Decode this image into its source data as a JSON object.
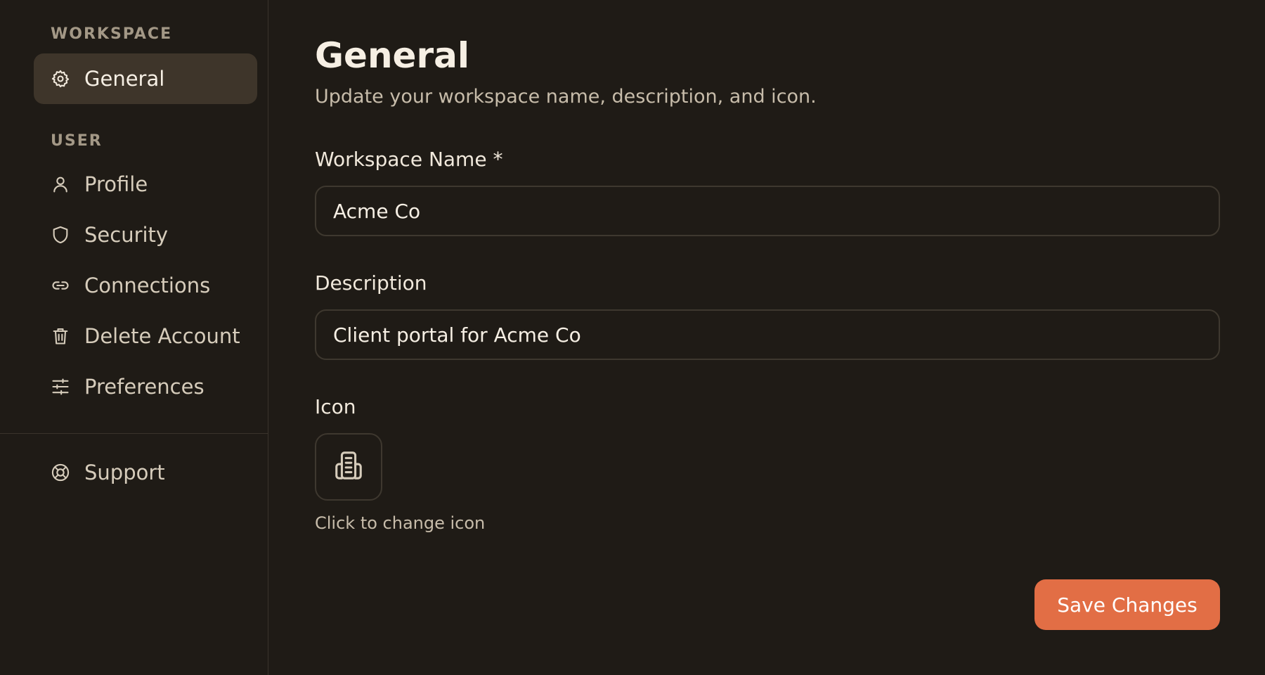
{
  "sidebar": {
    "workspace_label": "WORKSPACE",
    "user_label": "USER",
    "items": [
      {
        "label": "General",
        "icon": "gear-icon",
        "active": true
      },
      {
        "label": "Profile",
        "icon": "user-icon",
        "active": false
      },
      {
        "label": "Security",
        "icon": "shield-icon",
        "active": false
      },
      {
        "label": "Connections",
        "icon": "link-icon",
        "active": false
      },
      {
        "label": "Delete Account",
        "icon": "trash-icon",
        "active": false
      },
      {
        "label": "Preferences",
        "icon": "sliders-icon",
        "active": false
      },
      {
        "label": "Support",
        "icon": "lifebuoy-icon",
        "active": false
      }
    ]
  },
  "main": {
    "title": "General",
    "subtitle": "Update your workspace name, description, and icon.",
    "fields": {
      "name": {
        "label": "Workspace Name *",
        "value": "Acme Co"
      },
      "description": {
        "label": "Description",
        "value": "Client portal for Acme Co"
      },
      "icon": {
        "label": "Icon",
        "hint": "Click to change icon",
        "icon": "building-icon"
      }
    },
    "save_label": "Save Changes"
  },
  "colors": {
    "background": "#1f1b16",
    "active_item": "#3e352a",
    "accent": "#e26e45"
  }
}
